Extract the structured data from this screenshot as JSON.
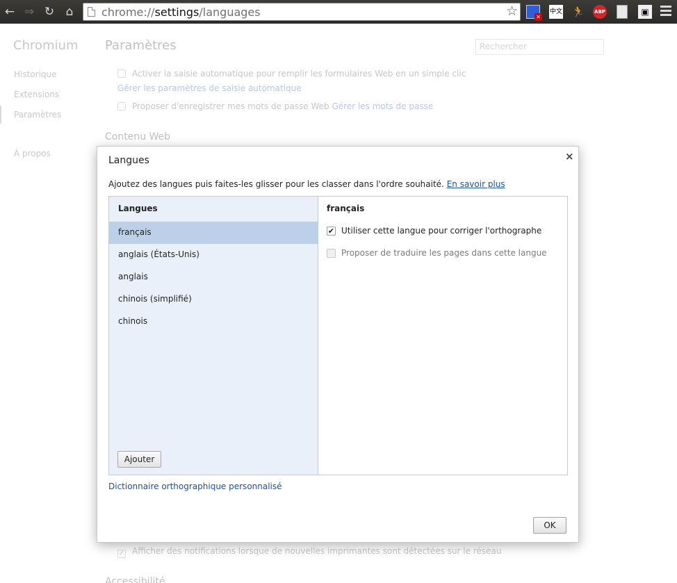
{
  "browser": {
    "url_scheme": "chrome://",
    "url_host": "settings",
    "url_path": "/languages"
  },
  "sidebar": {
    "brand": "Chromium",
    "items": [
      "Historique",
      "Extensions",
      "Paramètres",
      "À propos"
    ]
  },
  "settings": {
    "title": "Paramètres",
    "search_placeholder": "Rechercher",
    "autofill_label": "Activer la saisie automatique pour remplir les formulaires Web en un simple clic",
    "autofill_link": "Gérer les paramètres de saisie automatique",
    "passwords_label": "Proposer d'enregistrer mes mots de passe Web",
    "passwords_link": "Gérer les mots de passe",
    "web_content_section": "Contenu Web",
    "printers_label": "Afficher des notifications lorsque de nouvelles imprimantes sont détectées sur le réseau",
    "accessibility_section": "Accessibilité"
  },
  "dialog": {
    "title": "Langues",
    "close_symbol": "×",
    "intro_text": "Ajoutez des langues puis faites-les glisser pour les classer dans l'ordre souhaité.",
    "learn_more": "En savoir plus",
    "list_header": "Langues",
    "languages": [
      "français",
      "anglais (États-Unis)",
      "anglais",
      "chinois (simplifié)",
      "chinois"
    ],
    "selected_language": "français",
    "add_button": "Ajouter",
    "options": [
      {
        "label": "Utiliser cette langue pour corriger l'orthographe",
        "checked": true,
        "enabled": true
      },
      {
        "label": "Proposer de traduire les pages dans cette langue",
        "checked": false,
        "enabled": false
      }
    ],
    "dictionary_link": "Dictionnaire orthographique personnalisé",
    "ok_button": "OK"
  }
}
